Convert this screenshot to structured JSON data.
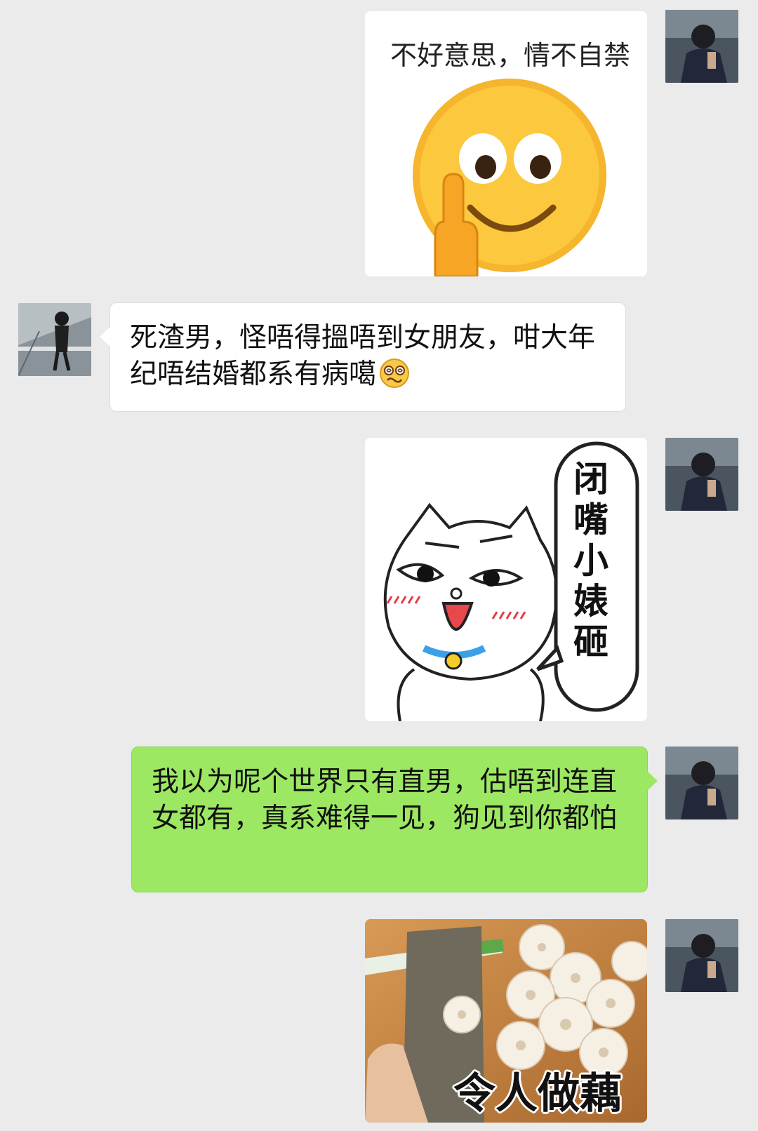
{
  "messages": [
    {
      "id": "m1",
      "side": "out",
      "kind": "sticker",
      "sticker_icon": "middle-finger-smiley-sticker",
      "caption": "不好意思，情不自禁"
    },
    {
      "id": "m2",
      "side": "in",
      "kind": "text",
      "text": "死渣男，怪唔得搵唔到女朋友，咁大年纪唔结婚都系有病噶",
      "trailing_emoji": "dizzy-face-emoji"
    },
    {
      "id": "m3",
      "side": "out",
      "kind": "sticker",
      "sticker_icon": "cartoon-cat-sticker",
      "caption": "闭嘴小婊砸"
    },
    {
      "id": "m4",
      "side": "out",
      "kind": "text",
      "text": "我以为呢个世界只有直男，估唔到连直女都有，真系难得一见，狗见到你都怕"
    },
    {
      "id": "m5",
      "side": "out",
      "kind": "sticker",
      "sticker_icon": "lotus-root-chopping-photo",
      "caption": "令人做藕"
    }
  ],
  "colors": {
    "background": "#ebebeb",
    "bubble_out": "#9de862",
    "bubble_in": "#ffffff"
  }
}
